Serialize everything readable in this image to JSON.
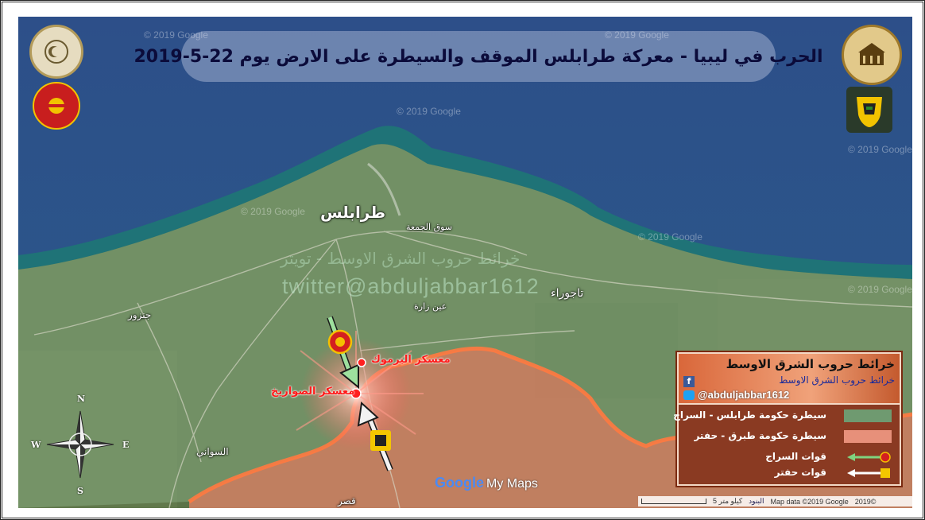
{
  "title": "الحرب في ليبيا - معركة طرابلس الموقف والسيطرة على الارض يوم  22-5-2019",
  "watermarks": {
    "google": "© 2019 Google",
    "twitter": "twitter@abduljabbar1612",
    "arabic": "خرائط حروب الشرق الاوسط - تويتر"
  },
  "places": {
    "tripoli": "طرابلس",
    "souq_jumaa": "سوق الجمعة",
    "tajoura": "تاجوراء",
    "ain_zara": "عين زارة",
    "janzour": "جنزور",
    "sawani": "السواني",
    "qasr": "قصر"
  },
  "camps": {
    "yarmouk": "معسكر اليرموك",
    "sawarikh": "معسكر الصواريخ"
  },
  "compass": {
    "n": "N",
    "s": "S",
    "e": "E",
    "w": "W"
  },
  "legend": {
    "header_title": "خرائط حروب الشرق الاوسط",
    "header_subtitle": "خرائط حروب الشرق الاوسط",
    "handle": "@abduljabbar1612",
    "rows": [
      {
        "label": "سيطرة حكومة طرابلس - السراج",
        "color": "#6f9a70"
      },
      {
        "label": "سيطرة حكومة طبرق - حفتر",
        "color": "#e7907a"
      },
      {
        "label": "قوات السراج",
        "color": "#7fd37f"
      },
      {
        "label": "قوات حفتر",
        "color": "#ffffff"
      }
    ]
  },
  "branding": {
    "google": "Google",
    "my_maps": "My Maps"
  },
  "attribution": {
    "scale": "5 كيلو متر",
    "terms": "البنود",
    "data": "Map data ©2019 Google",
    "copyright": "2019©"
  },
  "colors": {
    "sea": "#2c4f86",
    "coast": "#1e6f73",
    "land": "#5f7a4a",
    "gna_zone": "#8fb38a",
    "lna_zone": "#e8836a",
    "frontline": "#ff7a40"
  }
}
